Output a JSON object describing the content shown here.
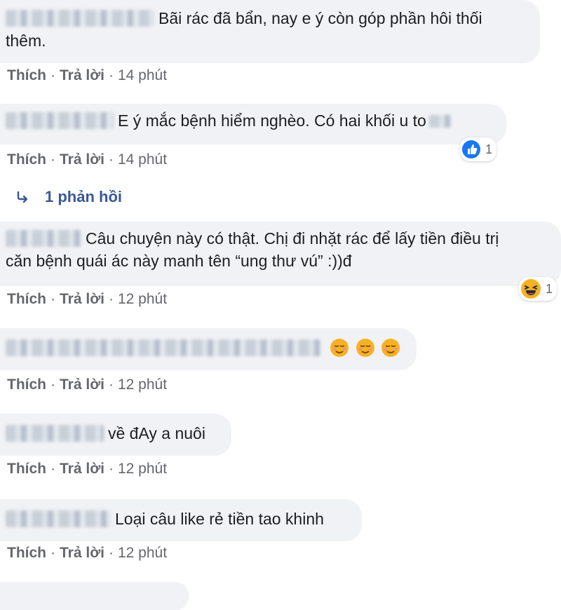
{
  "comments": [
    {
      "text_line1": "Bãi rác đã bẩn, nay e ý còn góp phần hôi thối",
      "text_line2": "thêm.",
      "like": "Thích",
      "reply": "Trả lời",
      "time": "14 phút"
    },
    {
      "text": "E ý mắc bệnh hiểm nghèo. Có hai khối u to",
      "like": "Thích",
      "reply": "Trả lời",
      "time": "14 phút",
      "reaction": {
        "icon": "like-icon",
        "count": "1",
        "color": "#1877f2"
      }
    },
    {
      "text_line1": "Câu chuyện này có thật. Chị đi nhặt rác để lấy tiền điều trị",
      "text_line2": "căn bệnh quái ác này manh tên “ung thư vú” :))đ",
      "like": "Thích",
      "reply": "Trả lời",
      "time": "12 phút",
      "reaction": {
        "icon": "haha-icon",
        "count": "1",
        "color": "#f7b125"
      }
    },
    {
      "emojis": [
        "relieved-face-icon",
        "relieved-face-icon",
        "relieved-face-icon"
      ],
      "like": "Thích",
      "reply": "Trả lời",
      "time": "12 phút"
    },
    {
      "text": "về đAy a nuôi",
      "like": "Thích",
      "reply": "Trả lời",
      "time": "12 phút"
    },
    {
      "text": "Loại câu like rẻ tiền tao khinh",
      "like": "Thích",
      "reply": "Trả lời",
      "time": "12 phút"
    }
  ],
  "replies_toggle": {
    "icon": "reply-arrow-icon",
    "label": "1 phản hồi"
  }
}
